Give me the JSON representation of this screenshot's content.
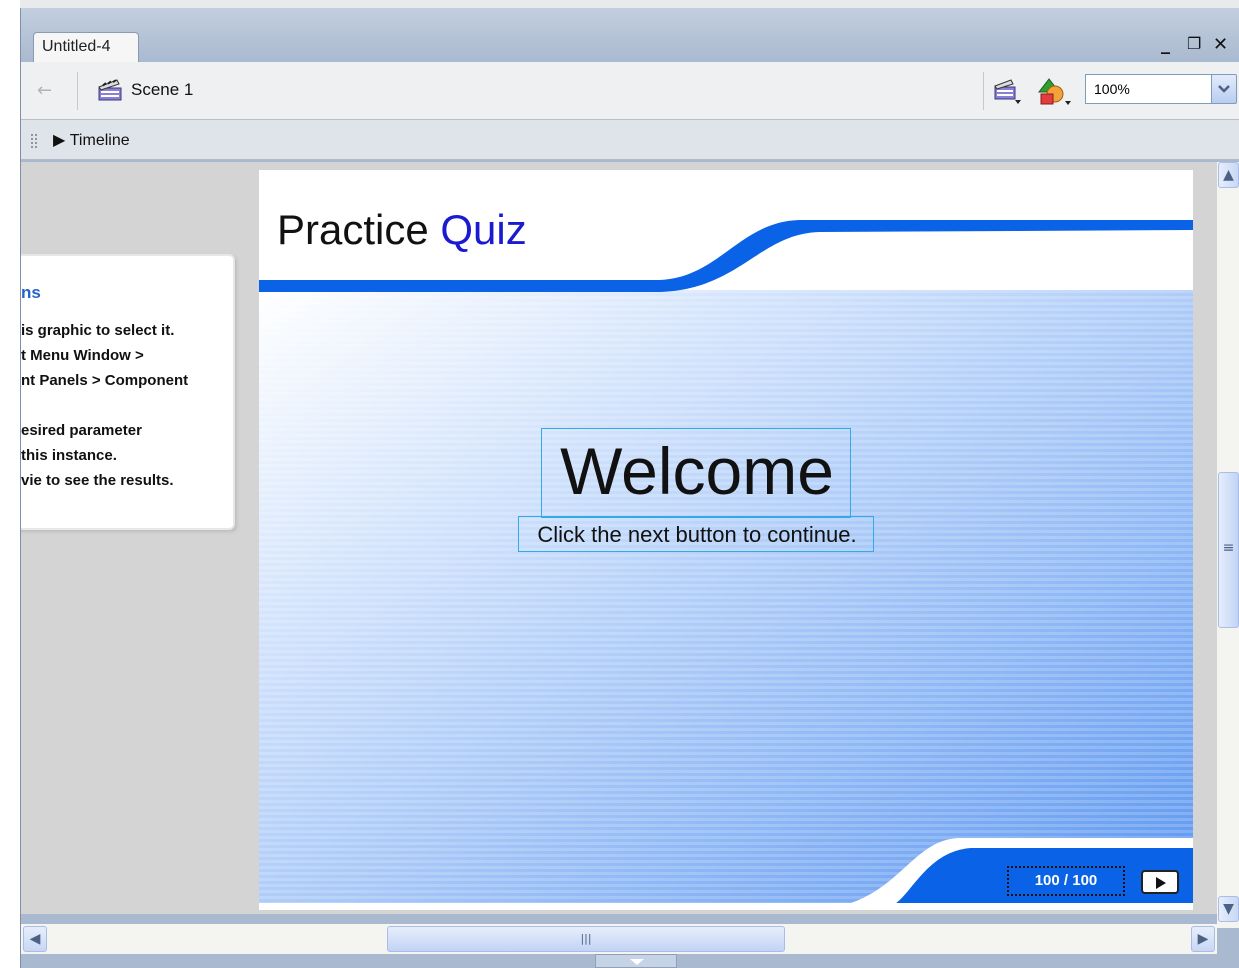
{
  "window": {
    "tab_title": "Untitled-4",
    "controls": {
      "minimize": "_",
      "restore": "❐",
      "close": "✕"
    }
  },
  "scene_bar": {
    "back_icon": "back-arrow-icon",
    "scene_label": "Scene 1",
    "zoom": "100%"
  },
  "timeline": {
    "label": "Timeline"
  },
  "instructions_panel": {
    "title": "ns",
    "lines": [
      "is graphic to select it.",
      "t Menu Window >",
      "nt Panels > Component",
      "",
      "esired parameter",
      "this instance.",
      "vie to see the results."
    ]
  },
  "stage": {
    "title_part1": "Practice",
    "title_part2": "Quiz",
    "welcome": "Welcome",
    "subtitle": "Click the next button to continue.",
    "page_counter": "100 / 100",
    "colors": {
      "accent_blue": "#0a62e6",
      "title_blue": "#1a1ad0"
    }
  },
  "scrollbars": {
    "up": "▲",
    "down": "▼",
    "left": "◀",
    "right": "▶",
    "grip_v": "≡",
    "grip_h": "|||"
  }
}
